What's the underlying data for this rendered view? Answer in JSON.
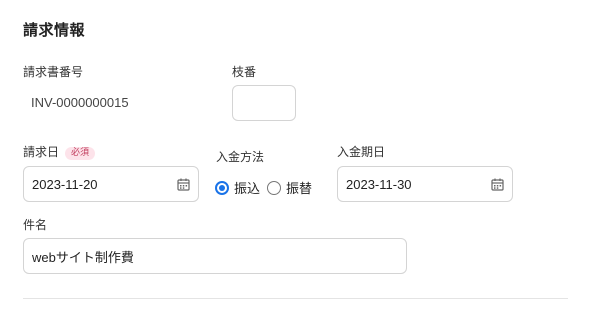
{
  "section": {
    "title": "請求情報"
  },
  "invoice_number": {
    "label": "請求書番号",
    "value": "INV-0000000015"
  },
  "branch_number": {
    "label": "枝番",
    "value": ""
  },
  "invoice_date": {
    "label": "請求日",
    "required_badge": "必須",
    "value": "2023-11-20",
    "icon": "calendar-icon"
  },
  "payment_method": {
    "label": "入金方法",
    "options": [
      {
        "label": "振込",
        "selected": true
      },
      {
        "label": "振替",
        "selected": false
      }
    ]
  },
  "payment_due": {
    "label": "入金期日",
    "value": "2023-11-30",
    "icon": "calendar-icon"
  },
  "subject": {
    "label": "件名",
    "value": "webサイト制作費"
  },
  "colors": {
    "accent": "#1a73e8",
    "required_badge_text": "#c0395a",
    "required_badge_bg": "#fde3ea",
    "border": "#d4d4d4"
  }
}
